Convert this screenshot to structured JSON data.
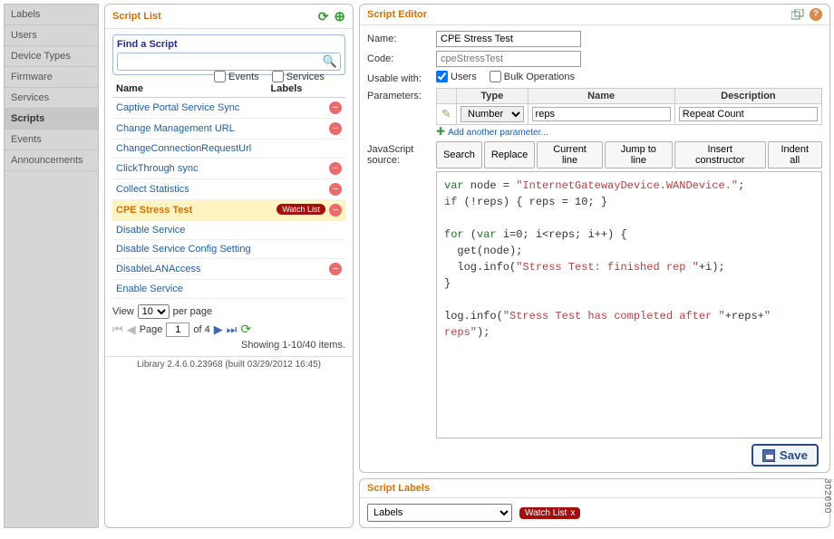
{
  "nav": {
    "items": [
      "Labels",
      "Users",
      "Device Types",
      "Firmware",
      "Services",
      "Scripts",
      "Events",
      "Announcements"
    ],
    "selectedIndex": 5
  },
  "scriptList": {
    "title": "Script List",
    "findTitle": "Find a Script",
    "searchPlaceholder": "",
    "headers": {
      "name": "Name",
      "labels": "Labels"
    },
    "rows": [
      {
        "name": "Captive Portal Service Sync",
        "del": true
      },
      {
        "name": "Change Management URL",
        "del": true
      },
      {
        "name": "ChangeConnectionRequestUrl"
      },
      {
        "name": "ClickThrough sync",
        "del": true
      },
      {
        "name": "Collect Statistics",
        "del": true
      },
      {
        "name": "CPE Stress Test",
        "watch": true,
        "selected": true,
        "del": true
      },
      {
        "name": "Disable Service"
      },
      {
        "name": "Disable Service Config Setting"
      },
      {
        "name": "DisableLANAccess",
        "del": true
      },
      {
        "name": "Enable Service"
      }
    ],
    "watchLabel": "Watch List",
    "pager": {
      "viewLabel": "View",
      "perPage": "10",
      "perPageSuffix": "per page",
      "pageLabel": "Page",
      "page": "1",
      "ofLabel": "of 4",
      "showing": "Showing 1-10/40 items."
    },
    "libFooter": "Library 2.4.6.0.23968 (built 03/29/2012 16:45)"
  },
  "editor": {
    "title": "Script Editor",
    "nameLabel": "Name:",
    "nameValue": "CPE Stress Test",
    "codeLabel": "Code:",
    "codeValue": "cpeStressTest",
    "usableLabel": "Usable with:",
    "usable": {
      "users": "Users",
      "bulk": "Bulk Operations",
      "events": "Events",
      "services": "Services"
    },
    "paramsLabel": "Parameters:",
    "paramHeaders": {
      "type": "Type",
      "name": "Name",
      "desc": "Description"
    },
    "paramRow": {
      "type": "Number",
      "name": "reps",
      "desc": "Repeat Count"
    },
    "addParam": "Add another parameter...",
    "jsLabel": "JavaScript source:",
    "jsButtons": [
      "Search",
      "Replace",
      "Current line",
      "Jump to line",
      "Insert constructor",
      "Indent all"
    ],
    "saveLabel": "Save"
  },
  "labelsPanel": {
    "title": "Script Labels",
    "dropdown": "Labels",
    "tag": "Watch List"
  },
  "sideId": "302690"
}
